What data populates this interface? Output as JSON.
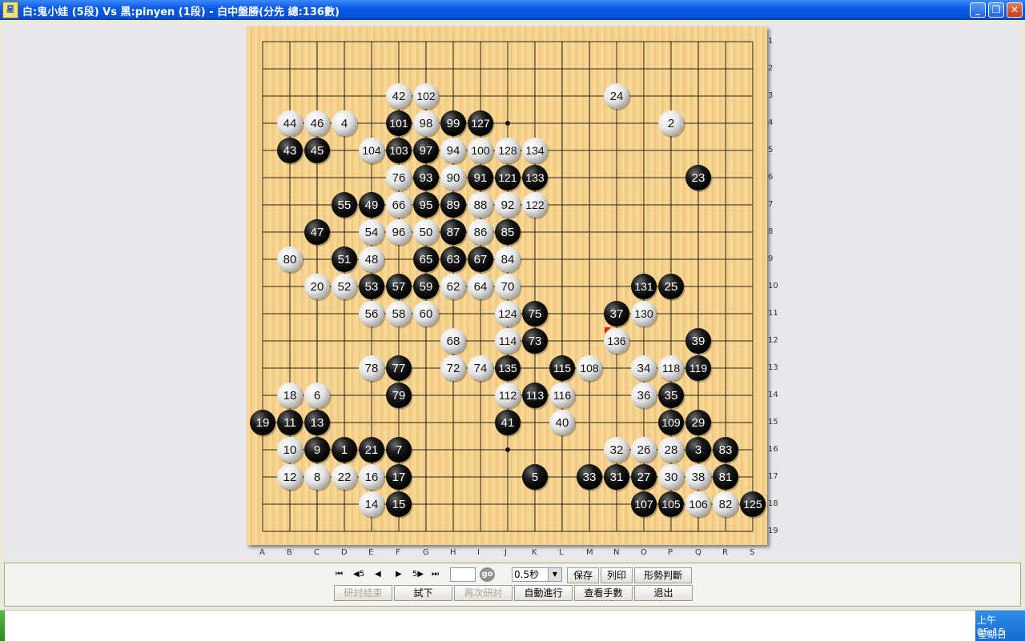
{
  "window": {
    "title": "白:鬼小娃 (5段) Vs 黑:pinyen (1段) - 白中盤勝(分先 總:136數)",
    "icon_text": "星",
    "controls": [
      "minimize-icon",
      "maximize-icon",
      "close-icon"
    ]
  },
  "board": {
    "size": 19,
    "col_labels": [
      "A",
      "B",
      "C",
      "D",
      "E",
      "F",
      "G",
      "H",
      "I",
      "J",
      "K",
      "L",
      "M",
      "N",
      "O",
      "P",
      "Q",
      "R",
      "S"
    ],
    "row_labels": [
      "1",
      "2",
      "3",
      "4",
      "5",
      "6",
      "7",
      "8",
      "9",
      "10",
      "11",
      "12",
      "13",
      "14",
      "15",
      "16",
      "17",
      "18",
      "19"
    ],
    "hoshi": [
      [
        9,
        3
      ],
      [
        9,
        15
      ]
    ],
    "last_move": [
      13,
      11
    ],
    "last_move_marker_color": "#e0251b",
    "stones": [
      {
        "c": 5,
        "r": 2,
        "n": "42",
        "color": "white"
      },
      {
        "c": 6,
        "r": 2,
        "n": "102",
        "color": "white"
      },
      {
        "c": 13,
        "r": 2,
        "n": "24",
        "color": "white"
      },
      {
        "c": 1,
        "r": 3,
        "n": "44",
        "color": "white"
      },
      {
        "c": 2,
        "r": 3,
        "n": "46",
        "color": "white"
      },
      {
        "c": 3,
        "r": 3,
        "n": "4",
        "color": "white"
      },
      {
        "c": 5,
        "r": 3,
        "n": "101",
        "color": "black"
      },
      {
        "c": 6,
        "r": 3,
        "n": "98",
        "color": "white"
      },
      {
        "c": 7,
        "r": 3,
        "n": "99",
        "color": "black"
      },
      {
        "c": 8,
        "r": 3,
        "n": "127",
        "color": "black"
      },
      {
        "c": 15,
        "r": 3,
        "n": "2",
        "color": "white"
      },
      {
        "c": 1,
        "r": 4,
        "n": "43",
        "color": "black"
      },
      {
        "c": 2,
        "r": 4,
        "n": "45",
        "color": "black"
      },
      {
        "c": 4,
        "r": 4,
        "n": "104",
        "color": "white"
      },
      {
        "c": 5,
        "r": 4,
        "n": "103",
        "color": "black"
      },
      {
        "c": 6,
        "r": 4,
        "n": "97",
        "color": "black"
      },
      {
        "c": 7,
        "r": 4,
        "n": "94",
        "color": "white"
      },
      {
        "c": 8,
        "r": 4,
        "n": "100",
        "color": "white"
      },
      {
        "c": 9,
        "r": 4,
        "n": "128",
        "color": "white"
      },
      {
        "c": 10,
        "r": 4,
        "n": "134",
        "color": "white"
      },
      {
        "c": 5,
        "r": 5,
        "n": "76",
        "color": "white"
      },
      {
        "c": 6,
        "r": 5,
        "n": "93",
        "color": "black"
      },
      {
        "c": 7,
        "r": 5,
        "n": "90",
        "color": "white"
      },
      {
        "c": 8,
        "r": 5,
        "n": "91",
        "color": "black"
      },
      {
        "c": 9,
        "r": 5,
        "n": "121",
        "color": "black"
      },
      {
        "c": 10,
        "r": 5,
        "n": "133",
        "color": "black"
      },
      {
        "c": 16,
        "r": 5,
        "n": "23",
        "color": "black"
      },
      {
        "c": 3,
        "r": 6,
        "n": "55",
        "color": "black"
      },
      {
        "c": 4,
        "r": 6,
        "n": "49",
        "color": "black"
      },
      {
        "c": 5,
        "r": 6,
        "n": "66",
        "color": "white"
      },
      {
        "c": 6,
        "r": 6,
        "n": "95",
        "color": "black"
      },
      {
        "c": 7,
        "r": 6,
        "n": "89",
        "color": "black"
      },
      {
        "c": 8,
        "r": 6,
        "n": "88",
        "color": "white"
      },
      {
        "c": 9,
        "r": 6,
        "n": "92",
        "color": "white"
      },
      {
        "c": 10,
        "r": 6,
        "n": "122",
        "color": "white"
      },
      {
        "c": 2,
        "r": 7,
        "n": "47",
        "color": "black"
      },
      {
        "c": 4,
        "r": 7,
        "n": "54",
        "color": "white"
      },
      {
        "c": 5,
        "r": 7,
        "n": "96",
        "color": "white"
      },
      {
        "c": 6,
        "r": 7,
        "n": "50",
        "color": "white"
      },
      {
        "c": 7,
        "r": 7,
        "n": "87",
        "color": "black"
      },
      {
        "c": 8,
        "r": 7,
        "n": "86",
        "color": "white"
      },
      {
        "c": 9,
        "r": 7,
        "n": "85",
        "color": "black"
      },
      {
        "c": 1,
        "r": 8,
        "n": "80",
        "color": "white"
      },
      {
        "c": 3,
        "r": 8,
        "n": "51",
        "color": "black"
      },
      {
        "c": 4,
        "r": 8,
        "n": "48",
        "color": "white"
      },
      {
        "c": 6,
        "r": 8,
        "n": "65",
        "color": "black"
      },
      {
        "c": 7,
        "r": 8,
        "n": "63",
        "color": "black"
      },
      {
        "c": 8,
        "r": 8,
        "n": "67",
        "color": "black"
      },
      {
        "c": 9,
        "r": 8,
        "n": "84",
        "color": "white"
      },
      {
        "c": 2,
        "r": 9,
        "n": "20",
        "color": "white"
      },
      {
        "c": 3,
        "r": 9,
        "n": "52",
        "color": "white"
      },
      {
        "c": 4,
        "r": 9,
        "n": "53",
        "color": "black"
      },
      {
        "c": 5,
        "r": 9,
        "n": "57",
        "color": "black"
      },
      {
        "c": 6,
        "r": 9,
        "n": "59",
        "color": "black"
      },
      {
        "c": 7,
        "r": 9,
        "n": "62",
        "color": "white"
      },
      {
        "c": 8,
        "r": 9,
        "n": "64",
        "color": "white"
      },
      {
        "c": 9,
        "r": 9,
        "n": "70",
        "color": "white"
      },
      {
        "c": 14,
        "r": 9,
        "n": "131",
        "color": "black"
      },
      {
        "c": 15,
        "r": 9,
        "n": "25",
        "color": "black"
      },
      {
        "c": 4,
        "r": 10,
        "n": "56",
        "color": "white"
      },
      {
        "c": 5,
        "r": 10,
        "n": "58",
        "color": "white"
      },
      {
        "c": 6,
        "r": 10,
        "n": "60",
        "color": "white"
      },
      {
        "c": 9,
        "r": 10,
        "n": "124",
        "color": "white"
      },
      {
        "c": 10,
        "r": 10,
        "n": "75",
        "color": "black"
      },
      {
        "c": 13,
        "r": 10,
        "n": "37",
        "color": "black"
      },
      {
        "c": 14,
        "r": 10,
        "n": "130",
        "color": "white"
      },
      {
        "c": 7,
        "r": 11,
        "n": "68",
        "color": "white"
      },
      {
        "c": 9,
        "r": 11,
        "n": "114",
        "color": "white"
      },
      {
        "c": 10,
        "r": 11,
        "n": "73",
        "color": "black"
      },
      {
        "c": 13,
        "r": 11,
        "n": "136",
        "color": "white"
      },
      {
        "c": 16,
        "r": 11,
        "n": "39",
        "color": "black"
      },
      {
        "c": 4,
        "r": 12,
        "n": "78",
        "color": "white"
      },
      {
        "c": 5,
        "r": 12,
        "n": "77",
        "color": "black"
      },
      {
        "c": 7,
        "r": 12,
        "n": "72",
        "color": "white"
      },
      {
        "c": 8,
        "r": 12,
        "n": "74",
        "color": "white"
      },
      {
        "c": 9,
        "r": 12,
        "n": "135",
        "color": "black"
      },
      {
        "c": 11,
        "r": 12,
        "n": "115",
        "color": "black"
      },
      {
        "c": 12,
        "r": 12,
        "n": "108",
        "color": "white"
      },
      {
        "c": 14,
        "r": 12,
        "n": "34",
        "color": "white"
      },
      {
        "c": 15,
        "r": 12,
        "n": "118",
        "color": "white"
      },
      {
        "c": 16,
        "r": 12,
        "n": "119",
        "color": "black"
      },
      {
        "c": 1,
        "r": 13,
        "n": "18",
        "color": "white"
      },
      {
        "c": 2,
        "r": 13,
        "n": "6",
        "color": "white"
      },
      {
        "c": 5,
        "r": 13,
        "n": "79",
        "color": "black"
      },
      {
        "c": 9,
        "r": 13,
        "n": "112",
        "color": "white"
      },
      {
        "c": 10,
        "r": 13,
        "n": "113",
        "color": "black"
      },
      {
        "c": 11,
        "r": 13,
        "n": "116",
        "color": "white"
      },
      {
        "c": 14,
        "r": 13,
        "n": "36",
        "color": "white"
      },
      {
        "c": 15,
        "r": 13,
        "n": "35",
        "color": "black"
      },
      {
        "c": 0,
        "r": 14,
        "n": "19",
        "color": "black"
      },
      {
        "c": 1,
        "r": 14,
        "n": "11",
        "color": "black"
      },
      {
        "c": 2,
        "r": 14,
        "n": "13",
        "color": "black"
      },
      {
        "c": 9,
        "r": 14,
        "n": "41",
        "color": "black"
      },
      {
        "c": 11,
        "r": 14,
        "n": "40",
        "color": "white"
      },
      {
        "c": 15,
        "r": 14,
        "n": "109",
        "color": "black"
      },
      {
        "c": 16,
        "r": 14,
        "n": "29",
        "color": "black"
      },
      {
        "c": 1,
        "r": 15,
        "n": "10",
        "color": "white"
      },
      {
        "c": 2,
        "r": 15,
        "n": "9",
        "color": "black"
      },
      {
        "c": 3,
        "r": 15,
        "n": "1",
        "color": "black"
      },
      {
        "c": 4,
        "r": 15,
        "n": "21",
        "color": "black"
      },
      {
        "c": 5,
        "r": 15,
        "n": "7",
        "color": "black"
      },
      {
        "c": 13,
        "r": 15,
        "n": "32",
        "color": "white"
      },
      {
        "c": 14,
        "r": 15,
        "n": "26",
        "color": "white"
      },
      {
        "c": 15,
        "r": 15,
        "n": "28",
        "color": "white"
      },
      {
        "c": 16,
        "r": 15,
        "n": "3",
        "color": "black"
      },
      {
        "c": 17,
        "r": 15,
        "n": "83",
        "color": "black"
      },
      {
        "c": 1,
        "r": 16,
        "n": "12",
        "color": "white"
      },
      {
        "c": 2,
        "r": 16,
        "n": "8",
        "color": "white"
      },
      {
        "c": 3,
        "r": 16,
        "n": "22",
        "color": "white"
      },
      {
        "c": 4,
        "r": 16,
        "n": "16",
        "color": "white"
      },
      {
        "c": 5,
        "r": 16,
        "n": "17",
        "color": "black"
      },
      {
        "c": 10,
        "r": 16,
        "n": "5",
        "color": "black"
      },
      {
        "c": 12,
        "r": 16,
        "n": "33",
        "color": "black"
      },
      {
        "c": 13,
        "r": 16,
        "n": "31",
        "color": "black"
      },
      {
        "c": 14,
        "r": 16,
        "n": "27",
        "color": "black"
      },
      {
        "c": 15,
        "r": 16,
        "n": "30",
        "color": "white"
      },
      {
        "c": 16,
        "r": 16,
        "n": "38",
        "color": "white"
      },
      {
        "c": 17,
        "r": 16,
        "n": "81",
        "color": "black"
      },
      {
        "c": 4,
        "r": 17,
        "n": "14",
        "color": "white"
      },
      {
        "c": 5,
        "r": 17,
        "n": "15",
        "color": "black"
      },
      {
        "c": 14,
        "r": 17,
        "n": "107",
        "color": "black"
      },
      {
        "c": 15,
        "r": 17,
        "n": "105",
        "color": "black"
      },
      {
        "c": 16,
        "r": 17,
        "n": "106",
        "color": "white"
      },
      {
        "c": 17,
        "r": 17,
        "n": "82",
        "color": "white"
      },
      {
        "c": 18,
        "r": 17,
        "n": "125",
        "color": "black"
      }
    ]
  },
  "controls": {
    "nav": {
      "first": "⏮",
      "back5": "◀5",
      "back": "◀",
      "forward": "▶",
      "forward5": "5▶",
      "last": "⏭"
    },
    "move_input_value": "",
    "go_label": "go",
    "speed_value": "0.5秒",
    "buttons": {
      "save": "保存",
      "print": "列印",
      "judge": "形勢判斷",
      "end_review": "研討結束",
      "try": "試下",
      "review_again": "再次研討",
      "auto_play": "自動進行",
      "view_moves": "查看手數",
      "exit": "退出"
    }
  },
  "taskbar": {
    "time": "上午 05:15",
    "day": "星期日"
  }
}
